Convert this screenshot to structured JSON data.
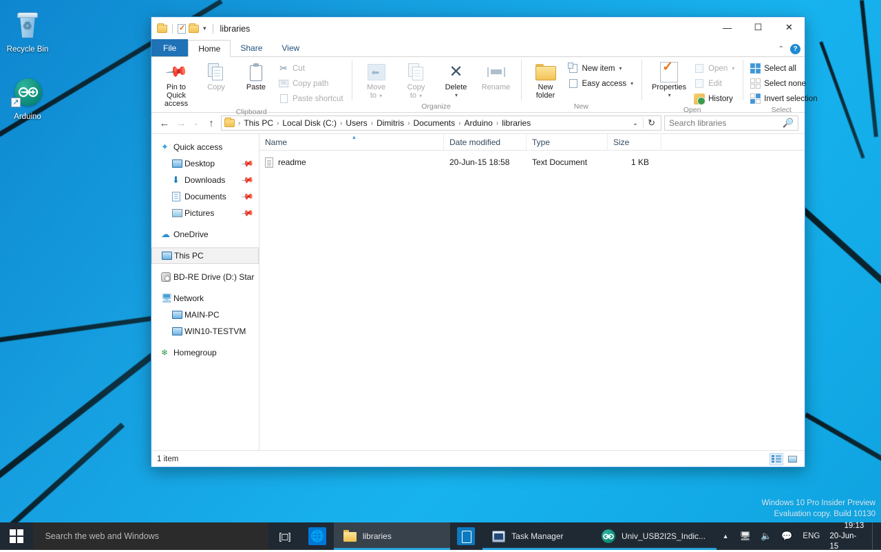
{
  "desktop": {
    "icons": [
      {
        "label": "Recycle Bin",
        "icon": "recycle-bin-icon"
      },
      {
        "label": "Arduino",
        "icon": "arduino-icon",
        "shortcut": true
      }
    ],
    "watermark_line1": "Windows 10 Pro Insider Preview",
    "watermark_line2": "Evaluation copy. Build 10130",
    "accent_color": "#0078d7",
    "wallpaper_color": "#17a3e0"
  },
  "explorer": {
    "title": "libraries",
    "quick_access_toolbar": [
      {
        "name": "folder-icon"
      },
      {
        "name": "properties-icon"
      },
      {
        "name": "new-folder-icon"
      },
      {
        "name": "customize-chevron"
      }
    ],
    "window_controls": {
      "minimize": "—",
      "maximize": "☐",
      "close": "✕"
    },
    "tabs": [
      {
        "label": "File",
        "active": false,
        "style": "file"
      },
      {
        "label": "Home",
        "active": true
      },
      {
        "label": "Share",
        "active": false
      },
      {
        "label": "View",
        "active": false
      }
    ],
    "ribbon_right": {
      "collapse": "⌃",
      "help": "?"
    },
    "ribbon": {
      "groups": [
        {
          "label": "Clipboard",
          "big_buttons": [
            {
              "label_line1": "Pin to Quick",
              "label_line2": "access",
              "icon": "pin-icon",
              "enabled": true
            },
            {
              "label_line1": "Copy",
              "label_line2": "",
              "icon": "copy-icon",
              "enabled": false
            },
            {
              "label_line1": "Paste",
              "label_line2": "",
              "icon": "paste-icon",
              "enabled": true
            }
          ],
          "small_buttons": [
            {
              "label": "Cut",
              "icon": "cut-icon",
              "enabled": false
            },
            {
              "label": "Copy path",
              "icon": "copy-path-icon",
              "enabled": false
            },
            {
              "label": "Paste shortcut",
              "icon": "paste-shortcut-icon",
              "enabled": false
            }
          ]
        },
        {
          "label": "Organize",
          "big_buttons": [
            {
              "label_line1": "Move",
              "label_line2": "to",
              "icon": "move-to-icon",
              "enabled": false,
              "dropdown": true
            },
            {
              "label_line1": "Copy",
              "label_line2": "to",
              "icon": "copy-to-icon",
              "enabled": false,
              "dropdown": true
            },
            {
              "label_line1": "Delete",
              "label_line2": "",
              "icon": "delete-icon",
              "enabled": true,
              "dropdown": true
            },
            {
              "label_line1": "Rename",
              "label_line2": "",
              "icon": "rename-icon",
              "enabled": false
            }
          ],
          "small_buttons": []
        },
        {
          "label": "New",
          "big_buttons": [
            {
              "label_line1": "New",
              "label_line2": "folder",
              "icon": "new-folder-icon",
              "enabled": true
            }
          ],
          "small_buttons": [
            {
              "label": "New item",
              "icon": "new-item-icon",
              "enabled": true,
              "dropdown": true
            },
            {
              "label": "Easy access",
              "icon": "easy-access-icon",
              "enabled": true,
              "dropdown": true
            }
          ]
        },
        {
          "label": "Open",
          "big_buttons": [
            {
              "label_line1": "Properties",
              "label_line2": "",
              "icon": "properties-icon",
              "enabled": true,
              "dropdown": true
            }
          ],
          "small_buttons": [
            {
              "label": "Open",
              "icon": "open-icon",
              "enabled": false,
              "dropdown": true
            },
            {
              "label": "Edit",
              "icon": "edit-icon",
              "enabled": false
            },
            {
              "label": "History",
              "icon": "history-icon",
              "enabled": true
            }
          ]
        },
        {
          "label": "Select",
          "big_buttons": [],
          "small_buttons": [
            {
              "label": "Select all",
              "icon": "select-all-icon",
              "enabled": true
            },
            {
              "label": "Select none",
              "icon": "select-none-icon",
              "enabled": true
            },
            {
              "label": "Invert selection",
              "icon": "invert-selection-icon",
              "enabled": true
            }
          ]
        }
      ]
    },
    "navigation": {
      "back": "←",
      "forward": "→",
      "recent": "⌄",
      "up": "↑",
      "breadcrumbs": [
        "This PC",
        "Local Disk (C:)",
        "Users",
        "Dimitris",
        "Documents",
        "Arduino",
        "libraries"
      ],
      "separator": "›",
      "dropdown": "⌄",
      "refresh": "↻"
    },
    "search": {
      "placeholder": "Search libraries",
      "icon": "search-icon"
    },
    "nav_pane": [
      {
        "label": "Quick access",
        "icon": "quick-access-star-icon",
        "level": 0,
        "pinned": false,
        "selected": false
      },
      {
        "label": "Desktop",
        "icon": "desktop-icon",
        "level": 1,
        "pinned": true,
        "selected": false
      },
      {
        "label": "Downloads",
        "icon": "downloads-icon",
        "level": 1,
        "pinned": true,
        "selected": false
      },
      {
        "label": "Documents",
        "icon": "documents-icon",
        "level": 1,
        "pinned": true,
        "selected": false
      },
      {
        "label": "Pictures",
        "icon": "pictures-icon",
        "level": 1,
        "pinned": true,
        "selected": false
      },
      {
        "label": "OneDrive",
        "icon": "onedrive-cloud-icon",
        "level": 0,
        "pinned": false,
        "selected": false,
        "gap_before": true
      },
      {
        "label": "This PC",
        "icon": "this-pc-icon",
        "level": 0,
        "pinned": false,
        "selected": true,
        "gap_before": true
      },
      {
        "label": "BD-RE Drive (D:) Star",
        "icon": "optical-drive-icon",
        "level": 0,
        "pinned": false,
        "selected": false,
        "gap_before": true
      },
      {
        "label": "Network",
        "icon": "network-icon",
        "level": 0,
        "pinned": false,
        "selected": false,
        "gap_before": true
      },
      {
        "label": "MAIN-PC",
        "icon": "computer-icon",
        "level": 1,
        "pinned": false,
        "selected": false
      },
      {
        "label": "WIN10-TESTVM",
        "icon": "computer-icon",
        "level": 1,
        "pinned": false,
        "selected": false
      },
      {
        "label": "Homegroup",
        "icon": "homegroup-icon",
        "level": 0,
        "pinned": false,
        "selected": false,
        "gap_before": true
      }
    ],
    "file_list": {
      "columns": [
        {
          "label": "Name",
          "key": "name",
          "sorted": true,
          "sort_dir": "asc"
        },
        {
          "label": "Date modified",
          "key": "date"
        },
        {
          "label": "Type",
          "key": "type"
        },
        {
          "label": "Size",
          "key": "size"
        }
      ],
      "rows": [
        {
          "name": "readme",
          "date": "20-Jun-15 18:58",
          "type": "Text Document",
          "size": "1 KB",
          "icon": "text-file-icon"
        }
      ]
    },
    "status": {
      "item_count": "1 item",
      "view_buttons": [
        {
          "name": "details-view-button",
          "active": true
        },
        {
          "name": "thumbnails-view-button",
          "active": false
        }
      ]
    }
  },
  "taskbar": {
    "start_button": "start-button",
    "search": {
      "placeholder": "Search the web and Windows"
    },
    "task_view": "task-view-button",
    "pinned": [
      {
        "name": "edge-icon",
        "label": ""
      },
      {
        "name": "store-icon",
        "label": ""
      }
    ],
    "apps": [
      {
        "label": "libraries",
        "icon": "folder-icon",
        "active": true
      },
      {
        "label": "Task Manager",
        "icon": "task-manager-icon",
        "active": false
      },
      {
        "label": "Univ_USB2I2S_Indic...",
        "icon": "arduino-icon",
        "active": false
      }
    ],
    "tray": {
      "show_hidden": "▲",
      "network_icon": "network-tray-icon",
      "volume_icon": "volume-tray-icon",
      "action_center_icon": "action-center-icon",
      "language": "ENG"
    },
    "clock": {
      "time": "19:13",
      "date": "20-Jun-15"
    }
  }
}
